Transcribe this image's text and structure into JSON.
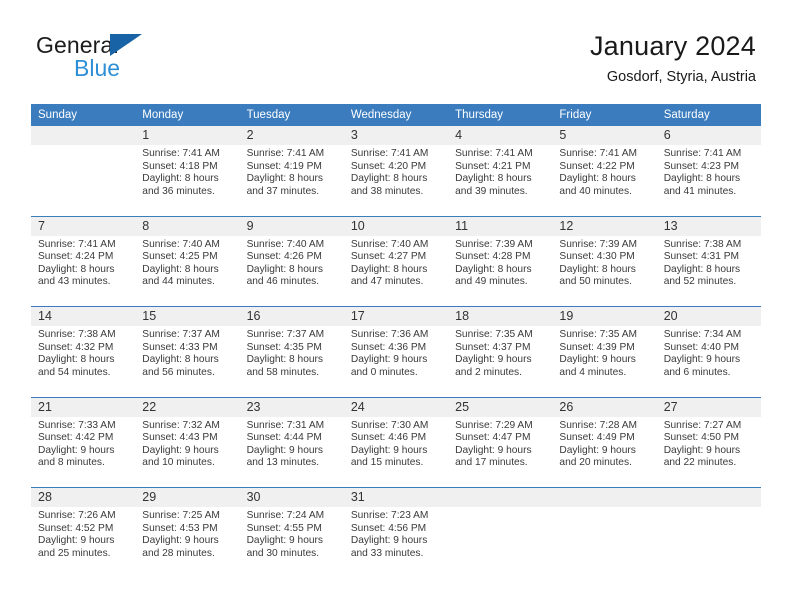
{
  "brand": {
    "line1": "General",
    "line2": "Blue",
    "triangle_color": "#1763a6",
    "blue_text_color": "#2f8fd6"
  },
  "header": {
    "title": "January 2024",
    "subtitle": "Gosdorf, Styria, Austria",
    "accent_color": "#3a7cbe"
  },
  "weekdays": [
    "Sunday",
    "Monday",
    "Tuesday",
    "Wednesday",
    "Thursday",
    "Friday",
    "Saturday"
  ],
  "weeks": [
    [
      {
        "day": "",
        "sunrise": "",
        "sunset": "",
        "daylight_line1": "",
        "daylight_line2": ""
      },
      {
        "day": "1",
        "sunrise": "Sunrise: 7:41 AM",
        "sunset": "Sunset: 4:18 PM",
        "daylight_line1": "Daylight: 8 hours",
        "daylight_line2": "and 36 minutes."
      },
      {
        "day": "2",
        "sunrise": "Sunrise: 7:41 AM",
        "sunset": "Sunset: 4:19 PM",
        "daylight_line1": "Daylight: 8 hours",
        "daylight_line2": "and 37 minutes."
      },
      {
        "day": "3",
        "sunrise": "Sunrise: 7:41 AM",
        "sunset": "Sunset: 4:20 PM",
        "daylight_line1": "Daylight: 8 hours",
        "daylight_line2": "and 38 minutes."
      },
      {
        "day": "4",
        "sunrise": "Sunrise: 7:41 AM",
        "sunset": "Sunset: 4:21 PM",
        "daylight_line1": "Daylight: 8 hours",
        "daylight_line2": "and 39 minutes."
      },
      {
        "day": "5",
        "sunrise": "Sunrise: 7:41 AM",
        "sunset": "Sunset: 4:22 PM",
        "daylight_line1": "Daylight: 8 hours",
        "daylight_line2": "and 40 minutes."
      },
      {
        "day": "6",
        "sunrise": "Sunrise: 7:41 AM",
        "sunset": "Sunset: 4:23 PM",
        "daylight_line1": "Daylight: 8 hours",
        "daylight_line2": "and 41 minutes."
      }
    ],
    [
      {
        "day": "7",
        "sunrise": "Sunrise: 7:41 AM",
        "sunset": "Sunset: 4:24 PM",
        "daylight_line1": "Daylight: 8 hours",
        "daylight_line2": "and 43 minutes."
      },
      {
        "day": "8",
        "sunrise": "Sunrise: 7:40 AM",
        "sunset": "Sunset: 4:25 PM",
        "daylight_line1": "Daylight: 8 hours",
        "daylight_line2": "and 44 minutes."
      },
      {
        "day": "9",
        "sunrise": "Sunrise: 7:40 AM",
        "sunset": "Sunset: 4:26 PM",
        "daylight_line1": "Daylight: 8 hours",
        "daylight_line2": "and 46 minutes."
      },
      {
        "day": "10",
        "sunrise": "Sunrise: 7:40 AM",
        "sunset": "Sunset: 4:27 PM",
        "daylight_line1": "Daylight: 8 hours",
        "daylight_line2": "and 47 minutes."
      },
      {
        "day": "11",
        "sunrise": "Sunrise: 7:39 AM",
        "sunset": "Sunset: 4:28 PM",
        "daylight_line1": "Daylight: 8 hours",
        "daylight_line2": "and 49 minutes."
      },
      {
        "day": "12",
        "sunrise": "Sunrise: 7:39 AM",
        "sunset": "Sunset: 4:30 PM",
        "daylight_line1": "Daylight: 8 hours",
        "daylight_line2": "and 50 minutes."
      },
      {
        "day": "13",
        "sunrise": "Sunrise: 7:38 AM",
        "sunset": "Sunset: 4:31 PM",
        "daylight_line1": "Daylight: 8 hours",
        "daylight_line2": "and 52 minutes."
      }
    ],
    [
      {
        "day": "14",
        "sunrise": "Sunrise: 7:38 AM",
        "sunset": "Sunset: 4:32 PM",
        "daylight_line1": "Daylight: 8 hours",
        "daylight_line2": "and 54 minutes."
      },
      {
        "day": "15",
        "sunrise": "Sunrise: 7:37 AM",
        "sunset": "Sunset: 4:33 PM",
        "daylight_line1": "Daylight: 8 hours",
        "daylight_line2": "and 56 minutes."
      },
      {
        "day": "16",
        "sunrise": "Sunrise: 7:37 AM",
        "sunset": "Sunset: 4:35 PM",
        "daylight_line1": "Daylight: 8 hours",
        "daylight_line2": "and 58 minutes."
      },
      {
        "day": "17",
        "sunrise": "Sunrise: 7:36 AM",
        "sunset": "Sunset: 4:36 PM",
        "daylight_line1": "Daylight: 9 hours",
        "daylight_line2": "and 0 minutes."
      },
      {
        "day": "18",
        "sunrise": "Sunrise: 7:35 AM",
        "sunset": "Sunset: 4:37 PM",
        "daylight_line1": "Daylight: 9 hours",
        "daylight_line2": "and 2 minutes."
      },
      {
        "day": "19",
        "sunrise": "Sunrise: 7:35 AM",
        "sunset": "Sunset: 4:39 PM",
        "daylight_line1": "Daylight: 9 hours",
        "daylight_line2": "and 4 minutes."
      },
      {
        "day": "20",
        "sunrise": "Sunrise: 7:34 AM",
        "sunset": "Sunset: 4:40 PM",
        "daylight_line1": "Daylight: 9 hours",
        "daylight_line2": "and 6 minutes."
      }
    ],
    [
      {
        "day": "21",
        "sunrise": "Sunrise: 7:33 AM",
        "sunset": "Sunset: 4:42 PM",
        "daylight_line1": "Daylight: 9 hours",
        "daylight_line2": "and 8 minutes."
      },
      {
        "day": "22",
        "sunrise": "Sunrise: 7:32 AM",
        "sunset": "Sunset: 4:43 PM",
        "daylight_line1": "Daylight: 9 hours",
        "daylight_line2": "and 10 minutes."
      },
      {
        "day": "23",
        "sunrise": "Sunrise: 7:31 AM",
        "sunset": "Sunset: 4:44 PM",
        "daylight_line1": "Daylight: 9 hours",
        "daylight_line2": "and 13 minutes."
      },
      {
        "day": "24",
        "sunrise": "Sunrise: 7:30 AM",
        "sunset": "Sunset: 4:46 PM",
        "daylight_line1": "Daylight: 9 hours",
        "daylight_line2": "and 15 minutes."
      },
      {
        "day": "25",
        "sunrise": "Sunrise: 7:29 AM",
        "sunset": "Sunset: 4:47 PM",
        "daylight_line1": "Daylight: 9 hours",
        "daylight_line2": "and 17 minutes."
      },
      {
        "day": "26",
        "sunrise": "Sunrise: 7:28 AM",
        "sunset": "Sunset: 4:49 PM",
        "daylight_line1": "Daylight: 9 hours",
        "daylight_line2": "and 20 minutes."
      },
      {
        "day": "27",
        "sunrise": "Sunrise: 7:27 AM",
        "sunset": "Sunset: 4:50 PM",
        "daylight_line1": "Daylight: 9 hours",
        "daylight_line2": "and 22 minutes."
      }
    ],
    [
      {
        "day": "28",
        "sunrise": "Sunrise: 7:26 AM",
        "sunset": "Sunset: 4:52 PM",
        "daylight_line1": "Daylight: 9 hours",
        "daylight_line2": "and 25 minutes."
      },
      {
        "day": "29",
        "sunrise": "Sunrise: 7:25 AM",
        "sunset": "Sunset: 4:53 PM",
        "daylight_line1": "Daylight: 9 hours",
        "daylight_line2": "and 28 minutes."
      },
      {
        "day": "30",
        "sunrise": "Sunrise: 7:24 AM",
        "sunset": "Sunset: 4:55 PM",
        "daylight_line1": "Daylight: 9 hours",
        "daylight_line2": "and 30 minutes."
      },
      {
        "day": "31",
        "sunrise": "Sunrise: 7:23 AM",
        "sunset": "Sunset: 4:56 PM",
        "daylight_line1": "Daylight: 9 hours",
        "daylight_line2": "and 33 minutes."
      },
      {
        "day": "",
        "sunrise": "",
        "sunset": "",
        "daylight_line1": "",
        "daylight_line2": ""
      },
      {
        "day": "",
        "sunrise": "",
        "sunset": "",
        "daylight_line1": "",
        "daylight_line2": ""
      },
      {
        "day": "",
        "sunrise": "",
        "sunset": "",
        "daylight_line1": "",
        "daylight_line2": ""
      }
    ]
  ]
}
